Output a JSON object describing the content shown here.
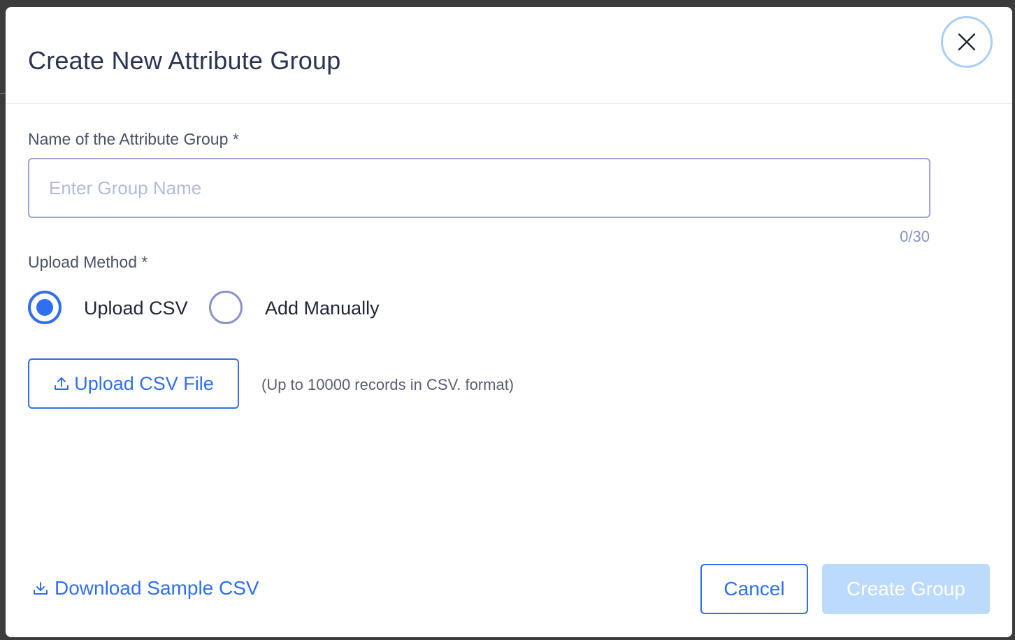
{
  "dialog": {
    "title": "Create New Attribute Group",
    "close_icon": "close-icon"
  },
  "form": {
    "name_label": "Name of the Attribute Group *",
    "name_placeholder": "Enter Group Name",
    "name_value": "",
    "name_counter": "0/30",
    "method_label": "Upload Method *",
    "method_options": [
      {
        "label": "Upload CSV",
        "selected": true
      },
      {
        "label": "Add Manually",
        "selected": false
      }
    ],
    "upload_button_label": "Upload CSV File",
    "upload_icon": "upload-icon",
    "upload_hint": "(Up to 10000 records in CSV. format)"
  },
  "footer": {
    "download_label": "Download Sample CSV",
    "download_icon": "download-icon",
    "cancel_label": "Cancel",
    "create_label": "Create Group",
    "create_enabled": false
  },
  "colors": {
    "primary": "#2f6ff0",
    "title_text": "#2a3452",
    "disabled_button": "#bcdafb",
    "close_ring": "#a9cff5"
  }
}
